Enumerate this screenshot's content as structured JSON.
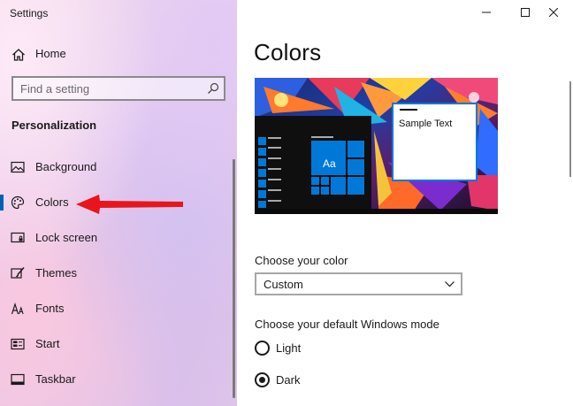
{
  "window": {
    "title": "Settings"
  },
  "sidebar": {
    "home_label": "Home",
    "search_placeholder": "Find a setting",
    "section_title": "Personalization",
    "items": [
      {
        "label": "Background",
        "icon": "picture-icon"
      },
      {
        "label": "Colors",
        "icon": "palette-icon",
        "selected": true
      },
      {
        "label": "Lock screen",
        "icon": "lock-screen-icon"
      },
      {
        "label": "Themes",
        "icon": "themes-brush-icon"
      },
      {
        "label": "Fonts",
        "icon": "fonts-icon"
      },
      {
        "label": "Start",
        "icon": "start-icon"
      },
      {
        "label": "Taskbar",
        "icon": "taskbar-icon"
      }
    ]
  },
  "main": {
    "page_title": "Colors",
    "preview": {
      "sample_text": "Sample Text",
      "tile_text": "Aa"
    },
    "choose_color": {
      "label": "Choose your color",
      "value": "Custom"
    },
    "windows_mode": {
      "label": "Choose your default Windows mode",
      "options": [
        {
          "label": "Light",
          "selected": false
        },
        {
          "label": "Dark",
          "selected": true
        }
      ]
    }
  },
  "colors": {
    "accent": "#0078d7",
    "selection_bar": "#0063b1",
    "annotation_arrow": "#e8161c"
  }
}
